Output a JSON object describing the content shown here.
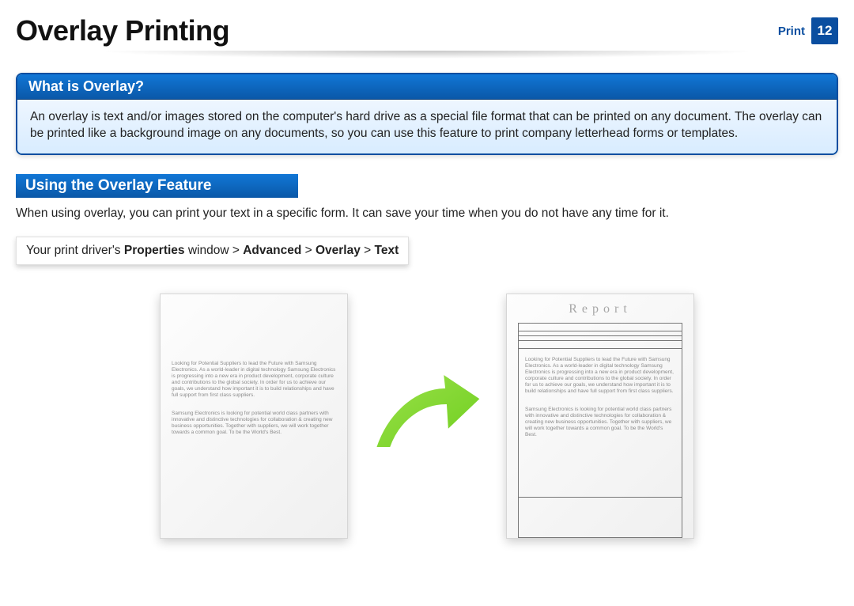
{
  "header": {
    "title": "Overlay Printing",
    "section": "Print",
    "page": "12"
  },
  "info_box": {
    "heading": "What is Overlay?",
    "body": "An overlay is text and/or images stored on the computer's hard drive as a special file format that can be printed on any document. The overlay can be printed like a background image on any documents, so you can use this feature to print company letterhead forms or templates."
  },
  "section_heading": "Using the Overlay Feature",
  "body_text": "When using overlay, you can print your text in a specific form. It can save your time when you do not have any time for it.",
  "path_bar": {
    "p1": "Your print driver's ",
    "p2": "Properties",
    "p3": " window > ",
    "p4": "Advanced",
    "p5": " > ",
    "p6": "Overlay",
    "p7": " > ",
    "p8": "Text"
  },
  "illustration": {
    "report_label": "Report",
    "sample_para1": "Looking for Potential Suppliers to lead the Future with Samsung Electronics. As a world-leader in digital technology Samsung Electronics is progressing into a new era in product development, corporate culture and contributions to the global society. In order for us to achieve our goals, we understand how important it is to build relationships and have full support from first class suppliers.",
    "sample_para2": "Samsung Electronics is looking for potential world class partners with innovative and distinctive technologies for collaboration & creating new business opportunities. Together with suppliers, we will work together towards a common goal. To be the World's Best."
  }
}
